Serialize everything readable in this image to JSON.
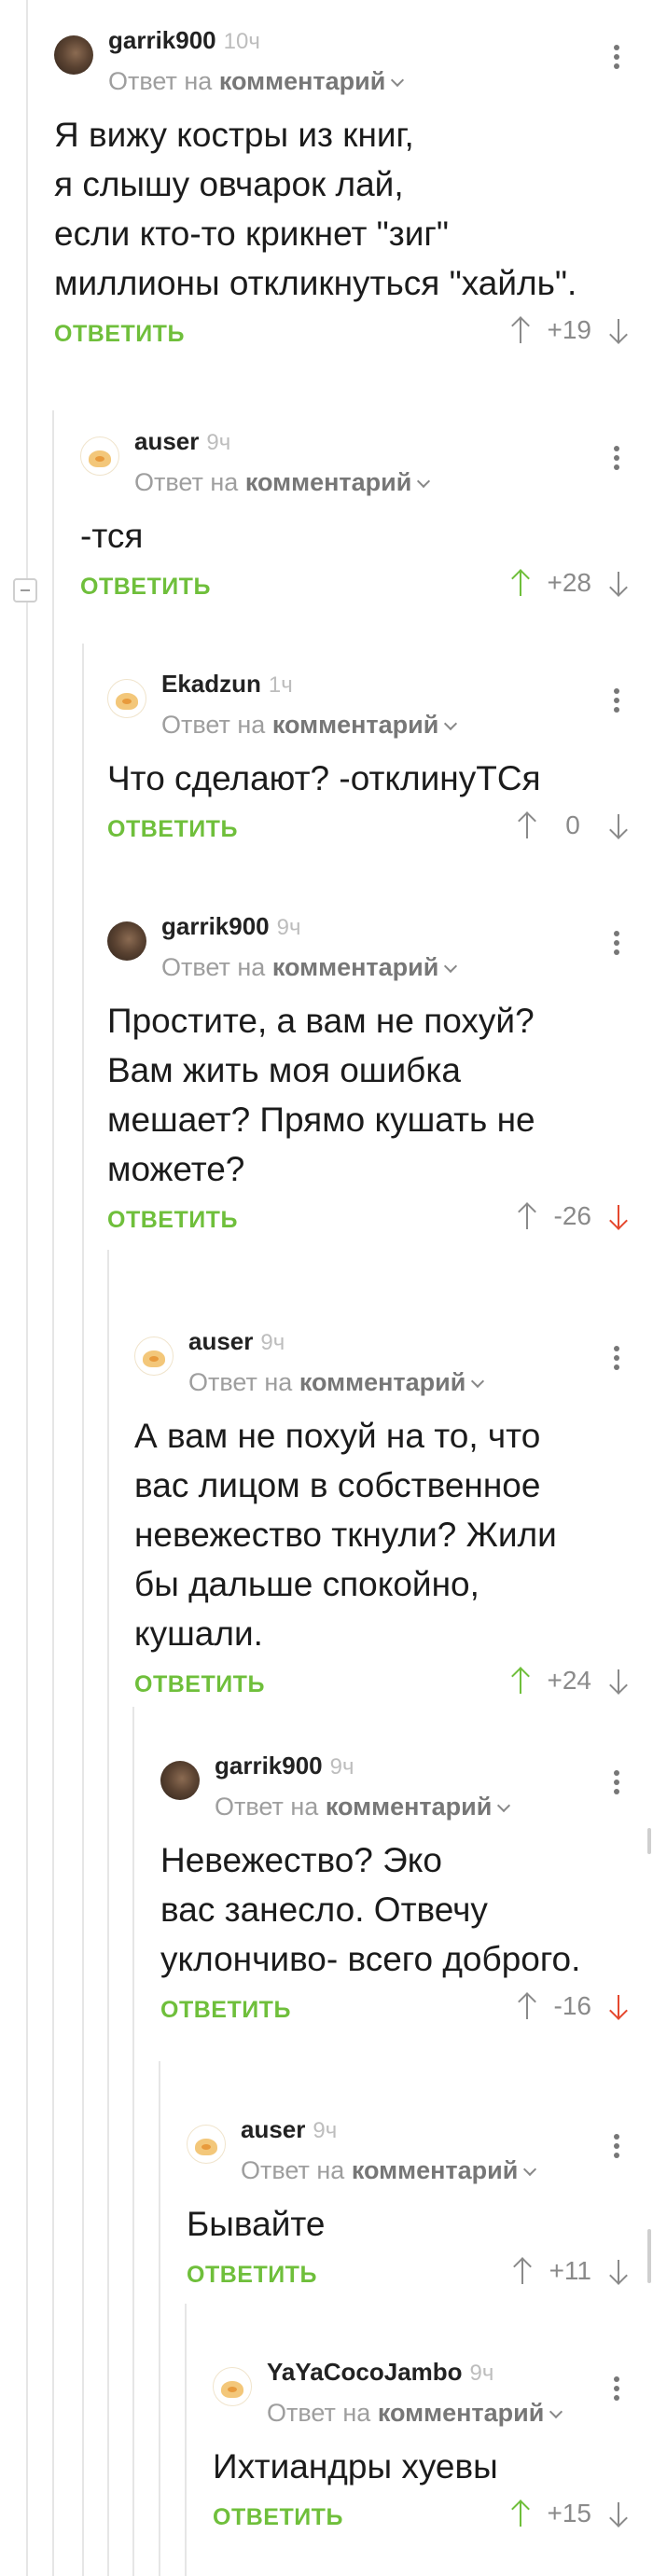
{
  "reply_label": "Ответ на",
  "comment_word": "комментарий",
  "reply_button": "ОТВЕТИТЬ",
  "comments": [
    {
      "author": "garrik900",
      "time": "10ч",
      "avatar": "dark",
      "body": [
        "Я вижу костры из книг,",
        "я слышу овчарок лай,",
        "если кто-то крикнет \"зиг\"",
        "миллионы откликнуться \"хайль\"."
      ],
      "score": "+19",
      "vote": "none"
    },
    {
      "author": "auser",
      "time": "9ч",
      "avatar": "cat",
      "body": [
        "-тся"
      ],
      "score": "+28",
      "vote": "up"
    },
    {
      "author": "Ekadzun",
      "time": "1ч",
      "avatar": "cat",
      "body": [
        "Что сделают? -отклинуТСя"
      ],
      "score": "0",
      "vote": "none"
    },
    {
      "author": "garrik900",
      "time": "9ч",
      "avatar": "dark",
      "body": [
        "Простите, а вам не похуй?",
        "Вам жить моя ошибка",
        "мешает? Прямо кушать не",
        "можете?"
      ],
      "score": "-26",
      "vote": "down"
    },
    {
      "author": "auser",
      "time": "9ч",
      "avatar": "cat",
      "body": [
        "А вам не похуй на то, что",
        "вас лицом в собственное",
        "невежество ткнули? Жили",
        "бы дальше спокойно,",
        "кушали."
      ],
      "score": "+24",
      "vote": "up"
    },
    {
      "author": "garrik900",
      "time": "9ч",
      "avatar": "dark",
      "body": [
        "Невежество? Эко",
        "вас занесло. Отвечу",
        "уклончиво- всего доброго."
      ],
      "score": "-16",
      "vote": "down"
    },
    {
      "author": "auser",
      "time": "9ч",
      "avatar": "cat",
      "body": [
        "Бывайте"
      ],
      "score": "+11",
      "vote": "none"
    },
    {
      "author": "YaYaCocoJambo",
      "time": "9ч",
      "avatar": "cat",
      "body": [
        "Ихтиандры хуевы"
      ],
      "score": "+15",
      "vote": "up"
    }
  ]
}
